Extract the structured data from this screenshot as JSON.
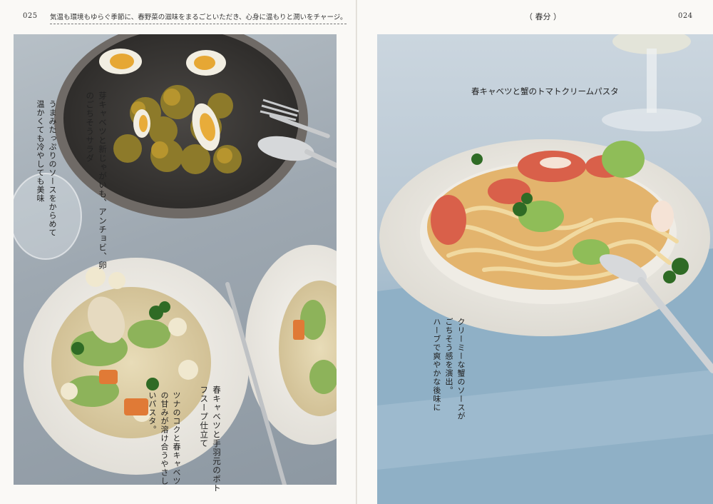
{
  "left_page": {
    "folio": "025",
    "header": "気温も環境もゆらぐ季節に、春野菜の滋味をまるごといただき、心身に温もりと潤いをチャージ。",
    "recipe_salad": {
      "title": "芽キャベツと新じゃがいも、アンチョビ、卵のごちそうサラダ",
      "caption": "うまみたっぷりのソースをからめて温かくても冷やしても美味"
    },
    "recipe_pasta": {
      "title": "春キャベツと手羽元のポトフスープ仕立て",
      "caption": "ツナのコクと春キャベツの甘みが溶け合うやさしいパスタ。"
    }
  },
  "right_page": {
    "section": "（ 春分 ）",
    "folio": "024",
    "recipe": {
      "title": "春キャベツと蟹のトマトクリームパスタ",
      "caption_lines": [
        "クリーミーな蟹のソースが",
        "ごちそう感を演出。",
        "ハーブで爽やかな後味に"
      ]
    }
  },
  "colors": {
    "paper": "#faf9f6",
    "table_left": "#9ea8b1",
    "table_right": "#b8c7d3",
    "napkin": "#8fb0c6"
  }
}
